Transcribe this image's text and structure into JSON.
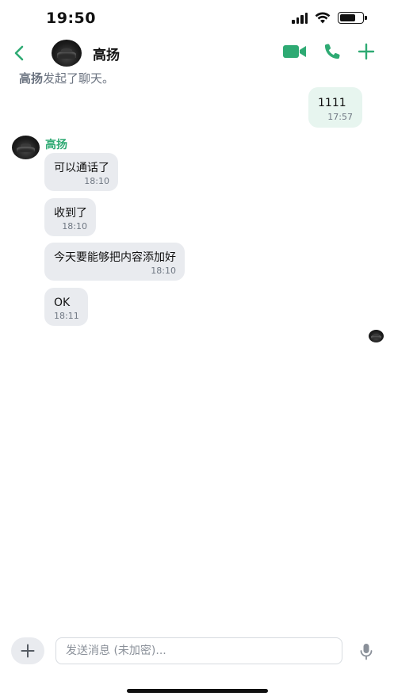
{
  "status_bar": {
    "time": "19:50"
  },
  "header": {
    "title": "高扬"
  },
  "system_notice": {
    "name": "高扬",
    "text": "发起了聊天。"
  },
  "messages_out": [
    {
      "text": "1111",
      "time": "17:57"
    }
  ],
  "sender": {
    "name": "高扬"
  },
  "messages_in": [
    {
      "text": "可以通话了",
      "time": "18:10"
    },
    {
      "text": "收到了",
      "time": "18:10"
    },
    {
      "text": "今天要能够把内容添加好",
      "time": "18:10"
    },
    {
      "text": "OK",
      "time": "18:11"
    }
  ],
  "composer": {
    "placeholder": "发送消息 (未加密)..."
  },
  "colors": {
    "accent": "#2eaa73",
    "bubble_out": "#e7f5ef",
    "bubble_in": "#e9ebef",
    "muted_text": "#6b7380"
  },
  "icons": [
    "back-chevron-icon",
    "video-call-icon",
    "phone-icon",
    "plus-icon",
    "microphone-icon"
  ]
}
